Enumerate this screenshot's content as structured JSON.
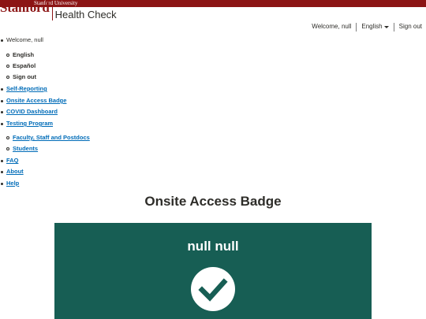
{
  "header": {
    "university": "Stanford University",
    "logo": "Stanford",
    "app_title": "Health Check"
  },
  "utility": {
    "welcome": "Welcome, null",
    "language": "English",
    "sign_out": "Sign out"
  },
  "nav": {
    "welcome": "Welcome, null",
    "lang_en": "English",
    "lang_es": "Español",
    "sign_out": "Sign out",
    "self_reporting": "Self-Reporting",
    "onsite_badge": "Onsite Access Badge",
    "covid_dashboard": "COVID Dashboard",
    "testing_program": "Testing Program",
    "faculty_staff": "Faculty, Staff and Postdocs",
    "students": "Students",
    "faq": "FAQ",
    "about": "About",
    "help": "Help"
  },
  "main": {
    "title": "Onsite Access Badge",
    "badge_name": "null null",
    "badge_icon": "check-circle-icon",
    "badge_color": "#175e54"
  },
  "colors": {
    "brand": "#8c1515",
    "link": "#006cb8"
  }
}
